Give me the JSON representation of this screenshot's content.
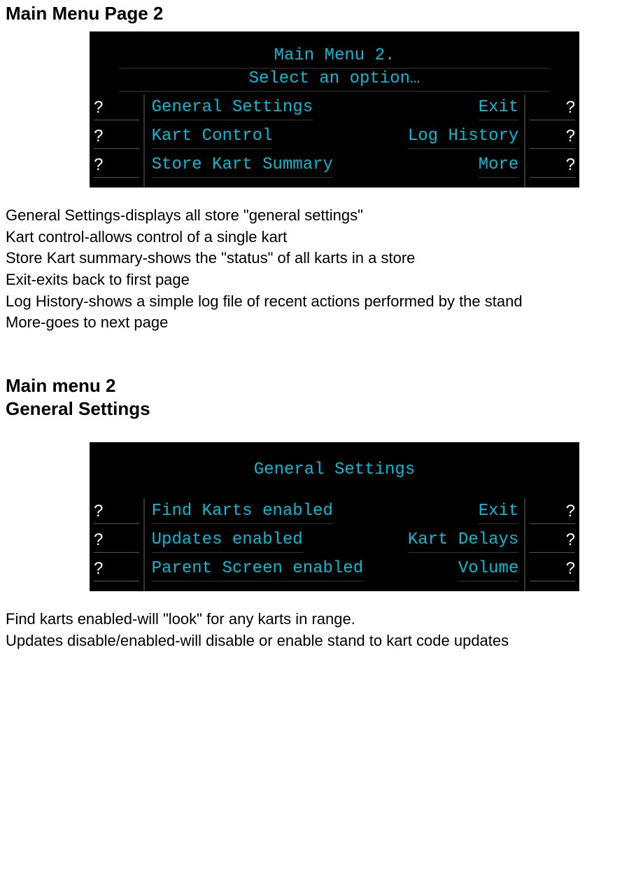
{
  "section1": {
    "heading": "Main Menu Page 2",
    "lcd": {
      "title": "Main Menu 2.",
      "subtitle": "Select an option…",
      "rows": [
        {
          "ql": "?",
          "left": "General Settings",
          "right": "Exit",
          "qr": "?"
        },
        {
          "ql": "?",
          "left": "Kart Control",
          "right": "Log History",
          "qr": "?"
        },
        {
          "ql": "?",
          "left": "Store Kart Summary",
          "right": "More",
          "qr": "?"
        }
      ]
    },
    "descriptions": [
      "General Settings-displays all store \"general settings\"",
      "Kart control-allows control of a single kart",
      "Store Kart summary-shows the \"status\" of all karts in a store",
      "Exit-exits back to first page",
      "Log History-shows a simple log file of recent actions performed by the stand",
      "More-goes to next page"
    ]
  },
  "section2": {
    "heading_line1": "Main menu 2",
    "heading_line2": "General Settings",
    "lcd": {
      "title": "General Settings",
      "subtitle": "",
      "rows": [
        {
          "ql": "?",
          "left": "Find Karts enabled",
          "right": "Exit",
          "qr": "?"
        },
        {
          "ql": "?",
          "left": "Updates enabled",
          "right": "Kart Delays",
          "qr": "?"
        },
        {
          "ql": "?",
          "left": "Parent Screen enabled",
          "right": "Volume",
          "qr": "?"
        }
      ]
    },
    "descriptions": [
      "Find karts enabled-will \"look\" for any karts in range.",
      "Updates disable/enabled-will disable or enable stand to kart code updates"
    ]
  }
}
